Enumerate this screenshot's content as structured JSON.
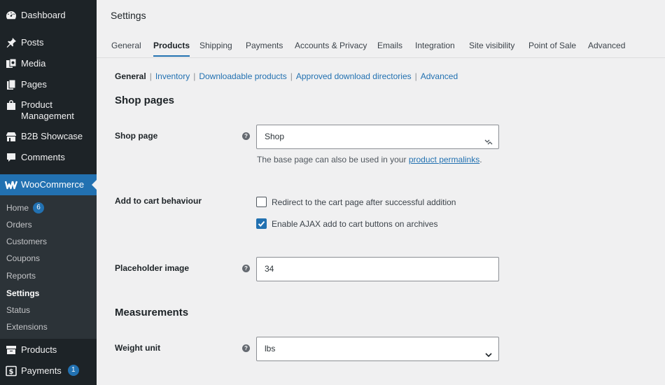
{
  "sidebar": {
    "top_items": [
      {
        "label": "Dashboard",
        "icon": "dashboard-icon"
      },
      {
        "label": "Posts",
        "icon": "pin-icon"
      },
      {
        "label": "Media",
        "icon": "media-icon"
      },
      {
        "label": "Pages",
        "icon": "pages-icon"
      },
      {
        "label": "Product Management",
        "icon": "store-icon"
      },
      {
        "label": "B2B Showcase",
        "icon": "building-icon"
      },
      {
        "label": "Comments",
        "icon": "comment-icon"
      }
    ],
    "woocommerce": {
      "label": "WooCommerce",
      "icon": "woocommerce-icon"
    },
    "submenu": [
      {
        "label": "Home",
        "count": "6"
      },
      {
        "label": "Orders"
      },
      {
        "label": "Customers"
      },
      {
        "label": "Coupons"
      },
      {
        "label": "Reports"
      },
      {
        "label": "Settings"
      },
      {
        "label": "Status"
      },
      {
        "label": "Extensions"
      }
    ],
    "bottom_items": [
      {
        "label": "Products",
        "icon": "archive-icon"
      },
      {
        "label": "Payments",
        "icon": "dollar-icon",
        "count": "1"
      }
    ]
  },
  "page": {
    "title": "Settings"
  },
  "tabs": [
    "General",
    "Products",
    "Shipping",
    "Payments",
    "Accounts & Privacy",
    "Emails",
    "Integration",
    "Site visibility",
    "Point of Sale",
    "Advanced"
  ],
  "subsections": [
    "General",
    "Inventory",
    "Downloadable products",
    "Approved download directories",
    "Advanced"
  ],
  "sections": {
    "shop_pages": "Shop pages",
    "measurements": "Measurements"
  },
  "fields": {
    "shop_page": {
      "label": "Shop page",
      "value": "Shop"
    },
    "shop_page_desc": {
      "prefix": "The base page can also be used in your ",
      "link": "product permalinks",
      "suffix": "."
    },
    "add_to_cart": {
      "label": "Add to cart behaviour",
      "option1": "Redirect to the cart page after successful addition",
      "option2": "Enable AJAX add to cart buttons on archives"
    },
    "placeholder": {
      "label": "Placeholder image",
      "value": "34"
    },
    "weight_unit": {
      "label": "Weight unit",
      "value": "lbs"
    }
  },
  "colors": {
    "accent": "#2271b1",
    "sidebar": "#1d2327",
    "submenu": "#2c3338"
  }
}
